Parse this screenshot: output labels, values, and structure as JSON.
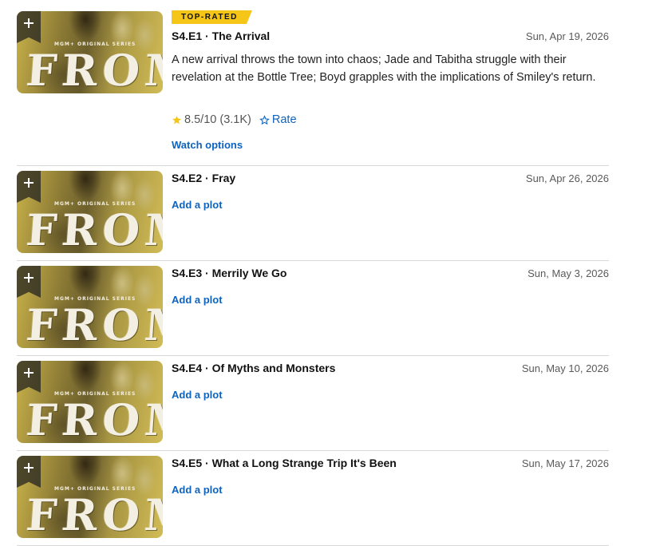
{
  "thumbnail": {
    "series_tag": "MGM+ ORIGINAL SERIES",
    "logo_text": "FROM",
    "add_icon": "plus-icon"
  },
  "colors": {
    "accent_yellow": "#f5c518",
    "link_blue": "#0e63be"
  },
  "episodes": [
    {
      "badge": "TOP-RATED",
      "title": "S4.E1 · The Arrival",
      "date": "Sun, Apr 19, 2026",
      "plot": "A new arrival throws the town into chaos; Jade and Tabitha struggle with their revelation at the Bottle Tree; Boyd grapples with the implications of Smiley's return.",
      "rating": "8.5",
      "rating_scale": "/10",
      "votes": "(3.1K)",
      "rate_label": "Rate",
      "watch_label": "Watch options"
    },
    {
      "title": "S4.E2 · Fray",
      "date": "Sun, Apr 26, 2026",
      "add_plot_label": "Add a plot"
    },
    {
      "title": "S4.E3 · Merrily We Go",
      "date": "Sun, May 3, 2026",
      "add_plot_label": "Add a plot"
    },
    {
      "title": "S4.E4 · Of Myths and Monsters",
      "date": "Sun, May 10, 2026",
      "add_plot_label": "Add a plot"
    },
    {
      "title": "S4.E5 · What a Long Strange Trip It's Been",
      "date": "Sun, May 17, 2026",
      "add_plot_label": "Add a plot"
    }
  ]
}
